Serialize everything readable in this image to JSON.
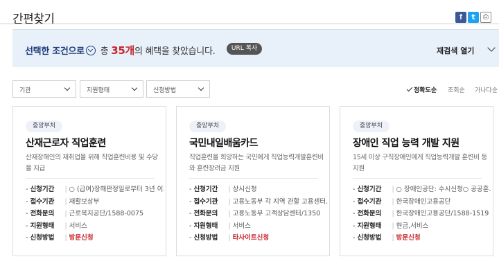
{
  "header": {
    "title": "간편찾기",
    "share": {
      "facebook": "f",
      "twitter": "t",
      "print": "⎙"
    }
  },
  "banner": {
    "selected_label": "선택한 조건으로",
    "prefix": "총",
    "count": "35개",
    "suffix": "의 혜택을 찾았습니다.",
    "url_copy": "URL 복사",
    "research": "재검색 열기"
  },
  "filters": [
    {
      "label": "기관"
    },
    {
      "label": "지원형태"
    },
    {
      "label": "신청방법"
    }
  ],
  "sort": {
    "options": [
      "정확도순",
      "조회순",
      "가나다순"
    ],
    "active": "정확도순"
  },
  "cards": [
    {
      "badge": "중앙부처",
      "title": "산재근로자 직업훈련",
      "desc": "산재장해인의 재취업을 위해 직업훈련비용 및 수당을 지급",
      "rows": [
        {
          "k": "신청기간",
          "v": "○ (급여)장해판정일로부터 3년 이..."
        },
        {
          "k": "접수기관",
          "v": "재활보상부"
        },
        {
          "k": "전화문의",
          "v": "근로복지공단/1588-0075"
        },
        {
          "k": "지원형태",
          "v": "서비스"
        },
        {
          "k": "신청방법",
          "v": "방문신청"
        }
      ]
    },
    {
      "badge": "중앙부처",
      "title": "국민내일배움카드",
      "desc": "직업훈련을 희망하는 국민에게 직업능력개발훈련비와 훈련장려금 지원",
      "rows": [
        {
          "k": "신청기간",
          "v": "상시신청"
        },
        {
          "k": "접수기관",
          "v": "고용노동부 각 지역 관할 고용센터..."
        },
        {
          "k": "전화문의",
          "v": "고용노동부 고객상담센터/1350"
        },
        {
          "k": "지원형태",
          "v": "서비스"
        },
        {
          "k": "신청방법",
          "v": "타사이트신청"
        }
      ]
    },
    {
      "badge": "중앙부처",
      "title": "장애인 직업 능력 개발 지원",
      "desc": "15세 이상 구직장애인에게 직업능력개발 훈련비 등 지원",
      "rows": [
        {
          "k": "신청기간",
          "v": "○ 장애인공단: 수시신청○ 공공훈..."
        },
        {
          "k": "접수기관",
          "v": "한국장애인고용공단"
        },
        {
          "k": "전화문의",
          "v": "한국장애인고용공단/1588-1519"
        },
        {
          "k": "지원형태",
          "v": "현금,서비스"
        },
        {
          "k": "신청방법",
          "v": "방문신청"
        }
      ]
    }
  ],
  "colors": {
    "accent": "#1f3e7a",
    "highlight": "#c8262b",
    "banner_bg": "#e8f0fa"
  }
}
